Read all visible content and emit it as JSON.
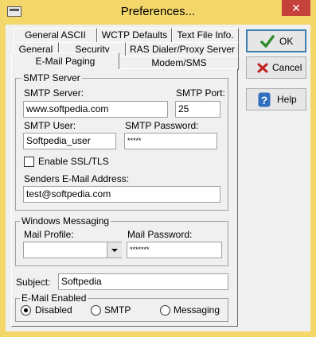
{
  "window": {
    "title": "Preferences...",
    "close_glyph": "✕"
  },
  "tabs": {
    "row1": [
      "General ASCII Data",
      "WCTP Defaults",
      "Text File Info."
    ],
    "row2": [
      "General",
      "Security",
      "RAS Dialer/Proxy Server"
    ],
    "row3": [
      "E-Mail Paging",
      "Modem/SMS"
    ],
    "active": "E-Mail Paging"
  },
  "smtp": {
    "group_label": "SMTP Server",
    "server_label": "SMTP Server:",
    "server_value": "www.softpedia.com",
    "port_label": "SMTP Port:",
    "port_value": "25",
    "user_label": "SMTP User:",
    "user_value": "Softpedia_user",
    "password_label": "SMTP Password:",
    "password_value": "*****",
    "ssl_label": "Enable SSL/TLS",
    "ssl_checked": false,
    "sender_label": "Senders E-Mail Address:",
    "sender_value": "test@softpedia.com"
  },
  "windows_messaging": {
    "group_label": "Windows Messaging",
    "profile_label": "Mail Profile:",
    "profile_value": "",
    "password_label": "Mail Password:",
    "password_value": "*******"
  },
  "subject": {
    "label": "Subject:",
    "value": "Softpedia"
  },
  "email_enabled": {
    "group_label": "E-Mail Enabled",
    "options": [
      "Disabled",
      "SMTP",
      "Messaging"
    ],
    "selected": "Disabled"
  },
  "buttons": {
    "ok": "OK",
    "cancel": "Cancel",
    "help": "Help"
  },
  "icons": {
    "ok": "check-icon",
    "cancel": "x-icon",
    "help": "question-icon"
  },
  "colors": {
    "titlebar": "#f4d76a",
    "close": "#c7413b",
    "check": "#2e8b2e",
    "cancel_x": "#c0201a"
  }
}
